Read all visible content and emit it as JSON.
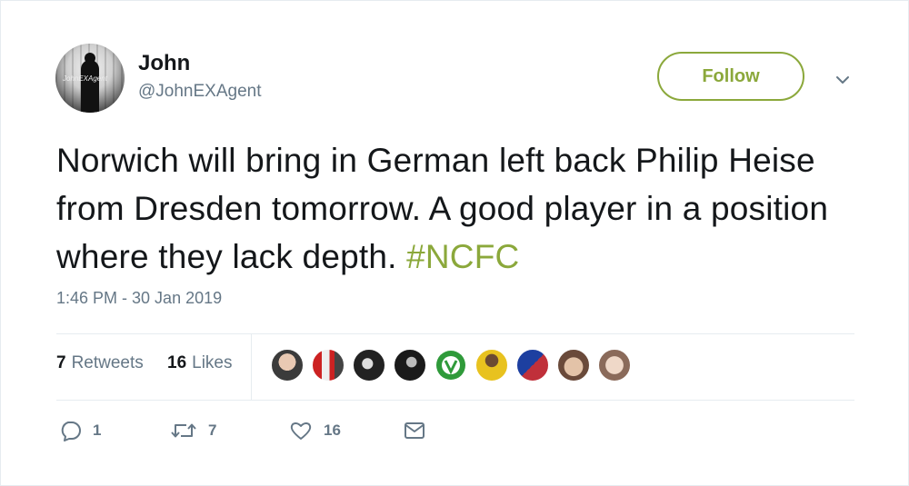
{
  "author": {
    "name": "John",
    "handle": "@JohnEXAgent",
    "avatar_text": "JohnEXAgent"
  },
  "follow": {
    "label": "Follow"
  },
  "tweet": {
    "text": "Norwich will bring in German left back Philip Heise from Dresden tomorrow. A good player in a position where they lack depth.",
    "hashtag": "#NCFC",
    "timestamp": "1:46 PM - 30 Jan 2019"
  },
  "stats": {
    "retweets_count": "7",
    "retweets_label": "Retweets",
    "likes_count": "16",
    "likes_label": "Likes"
  },
  "actions": {
    "reply_count": "1",
    "retweet_count": "7",
    "like_count": "16"
  },
  "colors": {
    "accent": "#8ba83b",
    "muted": "#657786",
    "text": "#14171a",
    "divider": "#e6ecf0"
  }
}
